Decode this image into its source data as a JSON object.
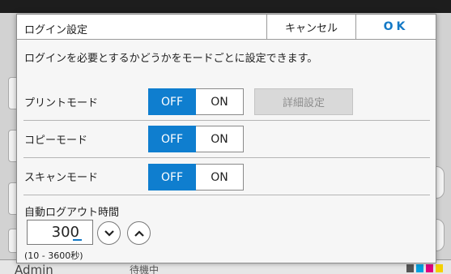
{
  "background": {
    "user": "Admin",
    "status": "待機中",
    "ink_colors": [
      "#555555",
      "#00a0e0",
      "#e0007f",
      "#f4d000"
    ]
  },
  "dialog": {
    "title": "ログイン設定",
    "cancel_label": "キャンセル",
    "ok_label": "OK",
    "description": "ログインを必要とするかどうかをモードごとに設定できます。"
  },
  "modes": [
    {
      "label": "プリントモード",
      "off_label": "OFF",
      "on_label": "ON",
      "selected": "OFF",
      "detail_label": "詳細設定",
      "detail_enabled": false
    },
    {
      "label": "コピーモード",
      "off_label": "OFF",
      "on_label": "ON",
      "selected": "OFF"
    },
    {
      "label": "スキャンモード",
      "off_label": "OFF",
      "on_label": "ON",
      "selected": "OFF"
    }
  ],
  "auto_logout": {
    "label": "自動ログアウト時間",
    "value": "300",
    "range": "(10 - 3600秒)",
    "decrement_icon": "chevron-down-icon",
    "increment_icon": "chevron-up-icon"
  },
  "colors": {
    "accent": "#0f7ecf",
    "ok_text": "#1479c6",
    "disabled_bg": "#d9d9d9"
  }
}
